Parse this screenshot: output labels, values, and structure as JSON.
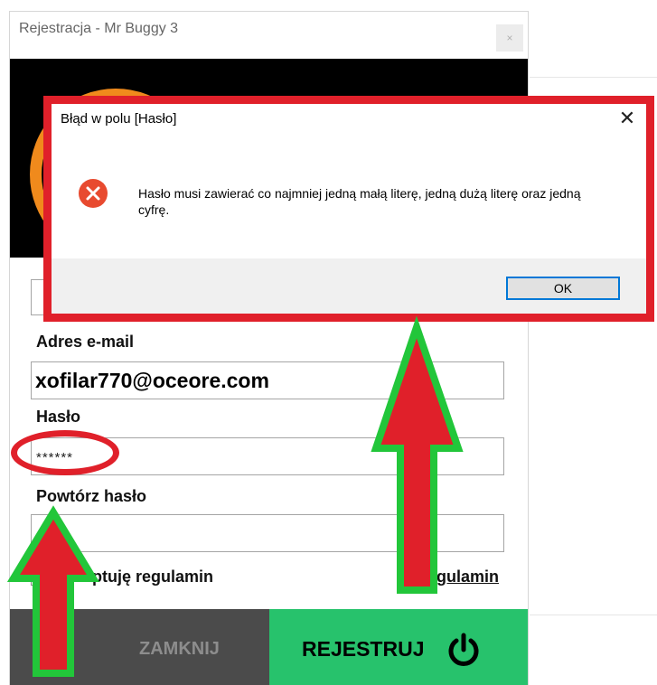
{
  "window": {
    "title": "Rejestracja - Mr Buggy 3",
    "close_glyph": "×"
  },
  "form": {
    "email_label": "Adres e-mail",
    "email_value": "xofilar770@oceore.com",
    "password_label": "Hasło",
    "password_value": "******",
    "repeat_label": "Powtórz hasło",
    "repeat_value": "",
    "terms_label": "Akceptuję regulamin",
    "terms_link": "Regulamin"
  },
  "buttons": {
    "close": "ZAMKNIJ",
    "register": "REJESTRUJ"
  },
  "dialog": {
    "title": "Błąd w polu [Hasło]",
    "close_glyph": "✕",
    "message": "Hasło musi zawierać co najmniej jedną małą literę, jedną dużą literę oraz jedną cyfrę.",
    "ok": "OK"
  },
  "colors": {
    "banner": "#000000",
    "logo_orange": "#f08a1c",
    "close_button_bg": "#4b4b4b",
    "register_button_bg": "#27c26c",
    "annotation_red": "#e0202a",
    "annotation_green": "#22c63a"
  },
  "icons": {
    "dialog_error": "error-x-circle-icon",
    "register_button": "power-icon"
  }
}
